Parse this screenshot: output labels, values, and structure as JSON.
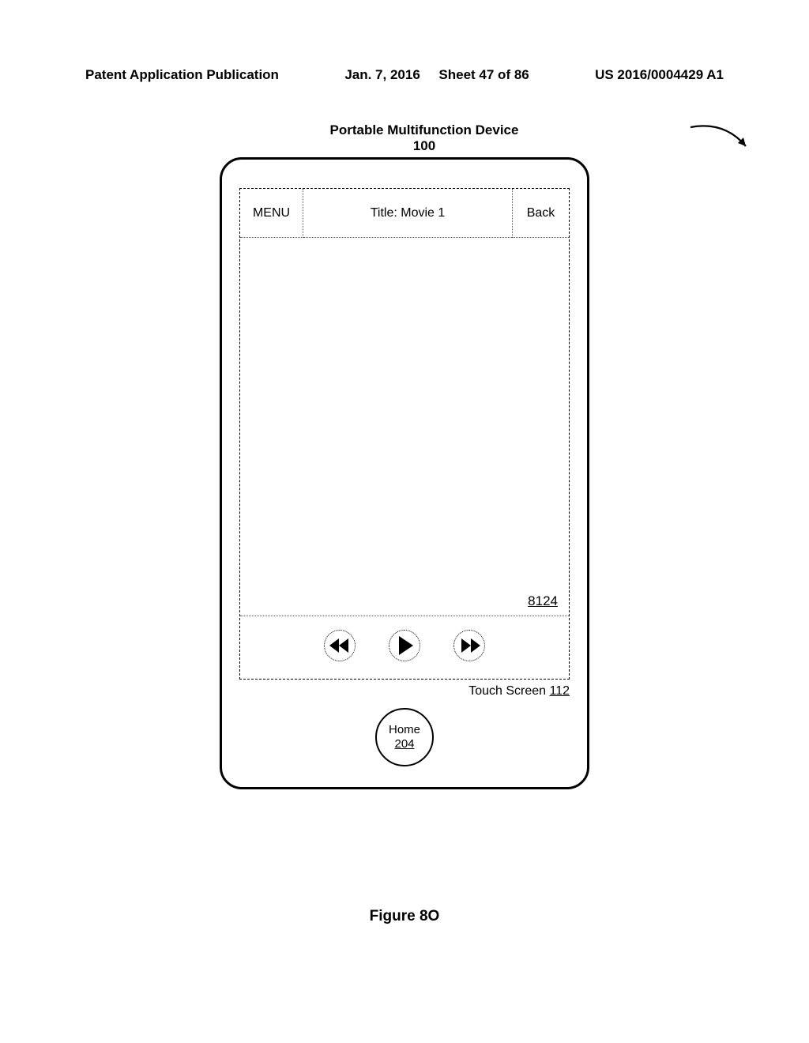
{
  "header": {
    "left": "Patent Application Publication",
    "mid_date": "Jan. 7, 2016",
    "mid_sheet": "Sheet 47 of 86",
    "right": "US 2016/0004429 A1"
  },
  "device": {
    "label": "Portable Multifunction Device",
    "ref_num": "100"
  },
  "topbar": {
    "menu": "MENU",
    "title": "Title: Movie 1",
    "back": "Back"
  },
  "content": {
    "ref_8124": "8124"
  },
  "touchscreen": {
    "label": "Touch Screen",
    "num": "112"
  },
  "home": {
    "label": "Home",
    "num": "204"
  },
  "figure_caption": "Figure 8O"
}
